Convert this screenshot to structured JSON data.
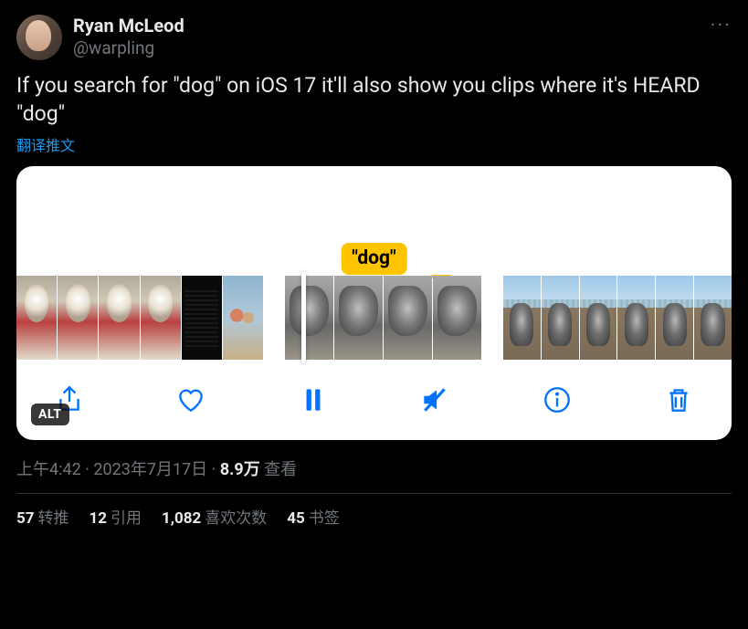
{
  "author": {
    "display_name": "Ryan McLeod",
    "handle": "@warpling"
  },
  "more_icon_label": "···",
  "body": "If you search for \"dog\" on iOS 17 it'll also show you clips where it's HEARD \"dog\"",
  "translate_label": "翻译推文",
  "media": {
    "caption_tag": "\"dog\"",
    "alt_badge": "ALT",
    "toolbar_icons": {
      "share": "share-icon",
      "like": "heart-icon",
      "pause": "pause-icon",
      "mute": "mute-icon",
      "info": "info-icon",
      "delete": "trash-icon"
    }
  },
  "meta": {
    "time": "上午4:42",
    "dot1": " · ",
    "date": "2023年7月17日",
    "dot2": " · ",
    "views_count": "8.9万",
    "views_label": " 查看"
  },
  "stats": {
    "retweets": {
      "count": "57",
      "label": "转推"
    },
    "quotes": {
      "count": "12",
      "label": "引用"
    },
    "likes": {
      "count": "1,082",
      "label": "喜欢次数"
    },
    "bookmarks": {
      "count": "45",
      "label": "书签"
    }
  }
}
